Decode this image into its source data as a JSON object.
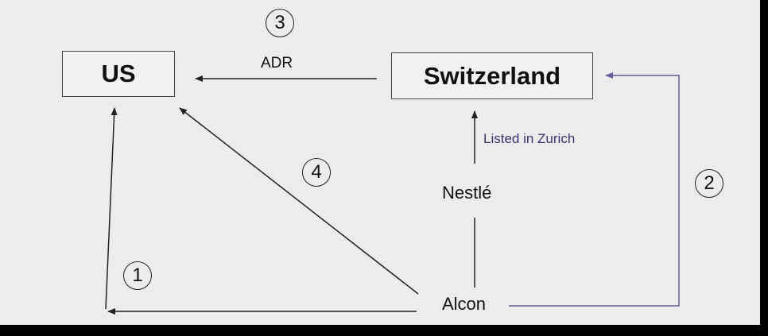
{
  "nodes": {
    "us": "US",
    "switzerland": "Switzerland",
    "nestle": "Nestlé",
    "alcon": "Alcon"
  },
  "edge_labels": {
    "adr": "ADR",
    "listed": "Listed in Zurich"
  },
  "steps": {
    "one": "1",
    "two": "2",
    "three": "3",
    "four": "4"
  },
  "colors": {
    "arrow": "#222222",
    "purple_arrow": "#6a5a9a",
    "background": "#ececec"
  }
}
